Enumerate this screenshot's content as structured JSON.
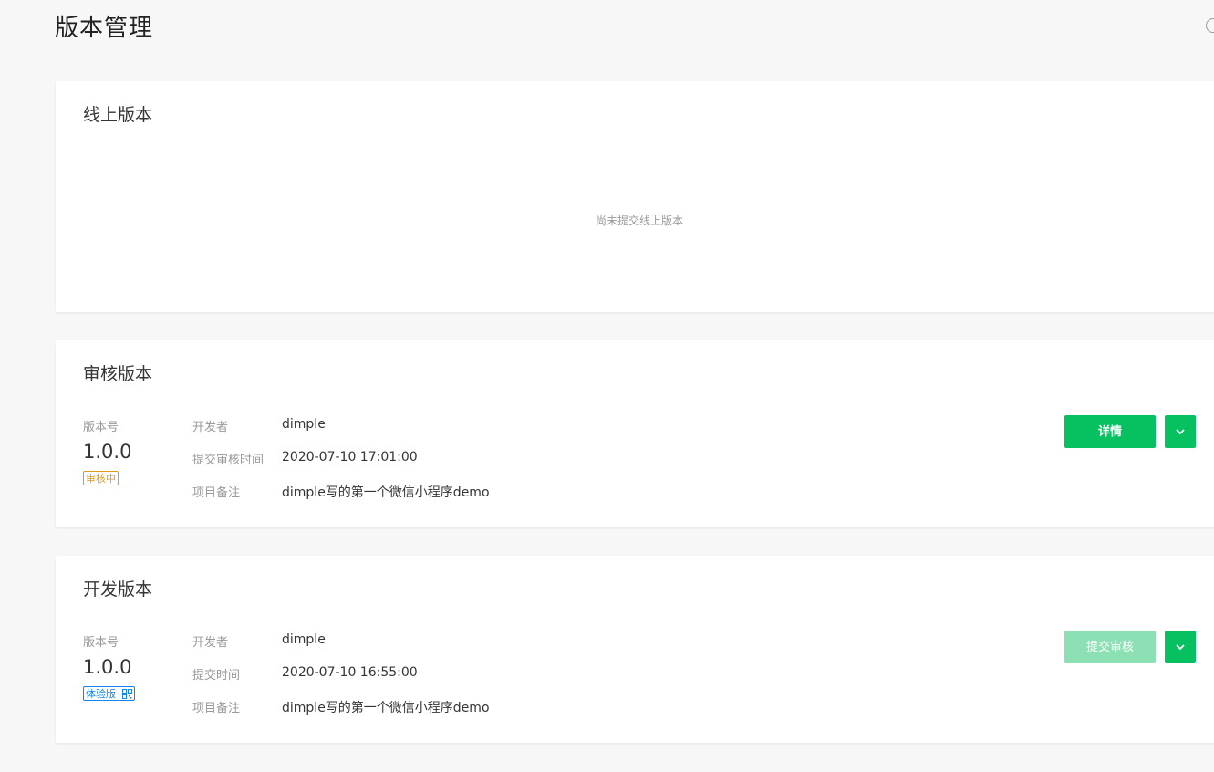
{
  "page": {
    "title": "版本管理"
  },
  "online": {
    "title": "线上版本",
    "empty_text": "尚未提交线上版本"
  },
  "review": {
    "title": "审核版本",
    "version_label": "版本号",
    "version": "1.0.0",
    "status_badge": "审核中",
    "rows": [
      {
        "label": "开发者",
        "value": "dimple"
      },
      {
        "label": "提交审核时间",
        "value": "2020-07-10 17:01:00"
      },
      {
        "label": "项目备注",
        "value": "dimple写的第一个微信小程序demo"
      }
    ],
    "primary_button": "详情"
  },
  "dev": {
    "title": "开发版本",
    "version_label": "版本号",
    "version": "1.0.0",
    "status_badge": "体验版",
    "rows": [
      {
        "label": "开发者",
        "value": "dimple"
      },
      {
        "label": "提交时间",
        "value": "2020-07-10 16:55:00"
      },
      {
        "label": "项目备注",
        "value": "dimple写的第一个微信小程序demo"
      }
    ],
    "primary_button": "提交审核"
  },
  "colors": {
    "accent": "#07c160",
    "accent_disabled": "#8ce0b4",
    "review_badge": "#e09b1b",
    "trial_badge": "#1485ee"
  },
  "icons": {
    "dropdown": "chevron-down-icon",
    "qr": "qrcode-icon",
    "help": "help-icon"
  }
}
